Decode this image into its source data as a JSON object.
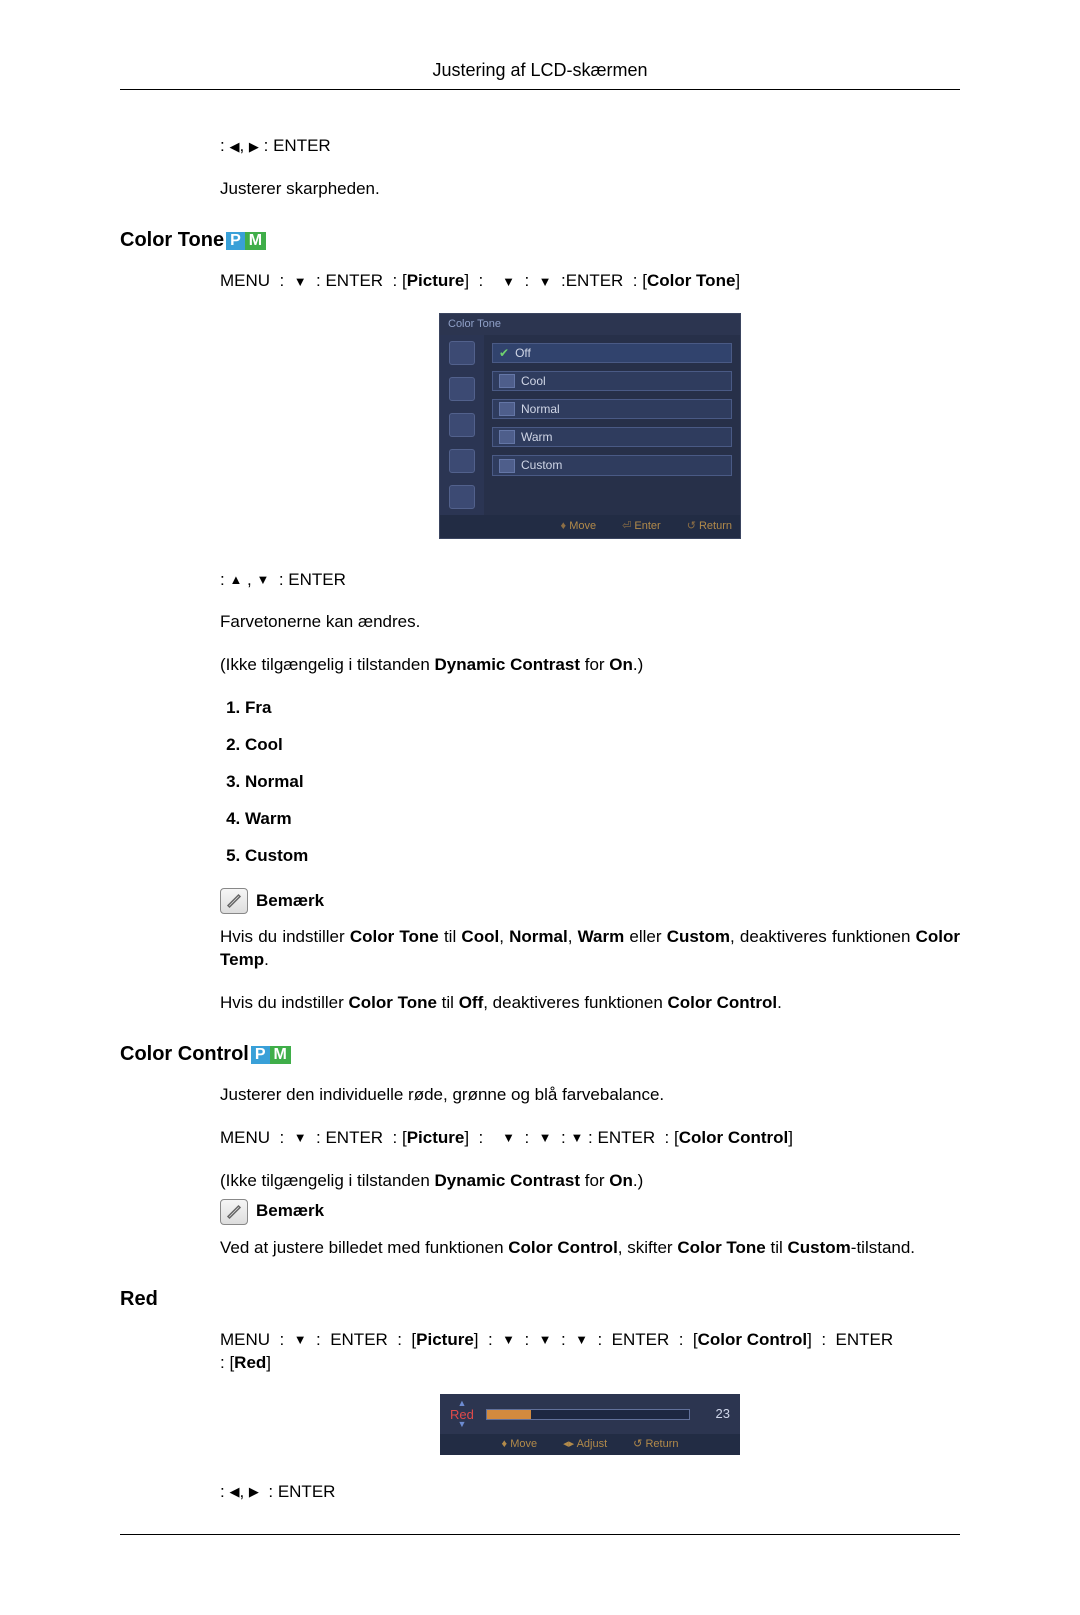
{
  "header": {
    "title": "Justering af LCD-skærmen"
  },
  "glyph": {
    "left": "◀",
    "right": "▶",
    "up": "▲",
    "down": "▼"
  },
  "lbl": {
    "enter": "ENTER",
    "menu": "MENU",
    "picture": "Picture",
    "colorTone": "Color Tone",
    "colorControl": "Color Control",
    "red": "Red",
    "note": "Bemærk"
  },
  "sec1": {
    "line": "Justerer skarpheden."
  },
  "colorTone": {
    "heading": "Color Tone",
    "osdTitle": "Color Tone",
    "items": [
      "Off",
      "Cool",
      "Normal",
      "Warm",
      "Custom"
    ],
    "foot": {
      "move": "Move",
      "enter": "Enter",
      "return": "Return"
    },
    "desc": "Farvetonerne kan ændres.",
    "avail_a": "(Ikke tilgængelig i tilstanden ",
    "avail_b": "Dynamic Contrast",
    "avail_c": " for ",
    "avail_d": "On",
    "avail_e": ".)",
    "opts": [
      "Fra",
      "Cool",
      "Normal",
      "Warm",
      "Custom"
    ],
    "note1_a": "Hvis du indstiller ",
    "note1_b": "Color Tone",
    "note1_c": " til ",
    "note1_d": "Cool",
    "note1_e": "Normal",
    "note1_f": "Warm",
    "note1_g": " eller ",
    "note1_h": "Custom",
    "note1_i": ", deaktiveres funktionen ",
    "note1_j": "Color Temp",
    "note1_k": ".",
    "note2_a": "Hvis du indstiller ",
    "note2_b": "Color Tone",
    "note2_c": " til ",
    "note2_d": "Off",
    "note2_e": ", deaktiveres funktionen ",
    "note2_f": "Color Control",
    "note2_g": "."
  },
  "colorControl": {
    "heading": "Color Control",
    "line1": "Justerer den individuelle røde, grønne og blå farvebalance.",
    "avail_a": "(Ikke tilgængelig i tilstanden ",
    "avail_b": "Dynamic Contrast",
    "avail_c": " for ",
    "avail_d": "On",
    "avail_e": ".)",
    "note_a": "Ved at justere billedet med funktionen ",
    "note_b": "Color Control",
    "note_c": ", skifter ",
    "note_d": "Color Tone",
    "note_e": " til ",
    "note_f": "Custom",
    "note_g": "-tilstand."
  },
  "red": {
    "heading": "Red",
    "label": "Red",
    "value": "23",
    "foot": {
      "move": "Move",
      "adjust": "Adjust",
      "return": "Return"
    }
  }
}
